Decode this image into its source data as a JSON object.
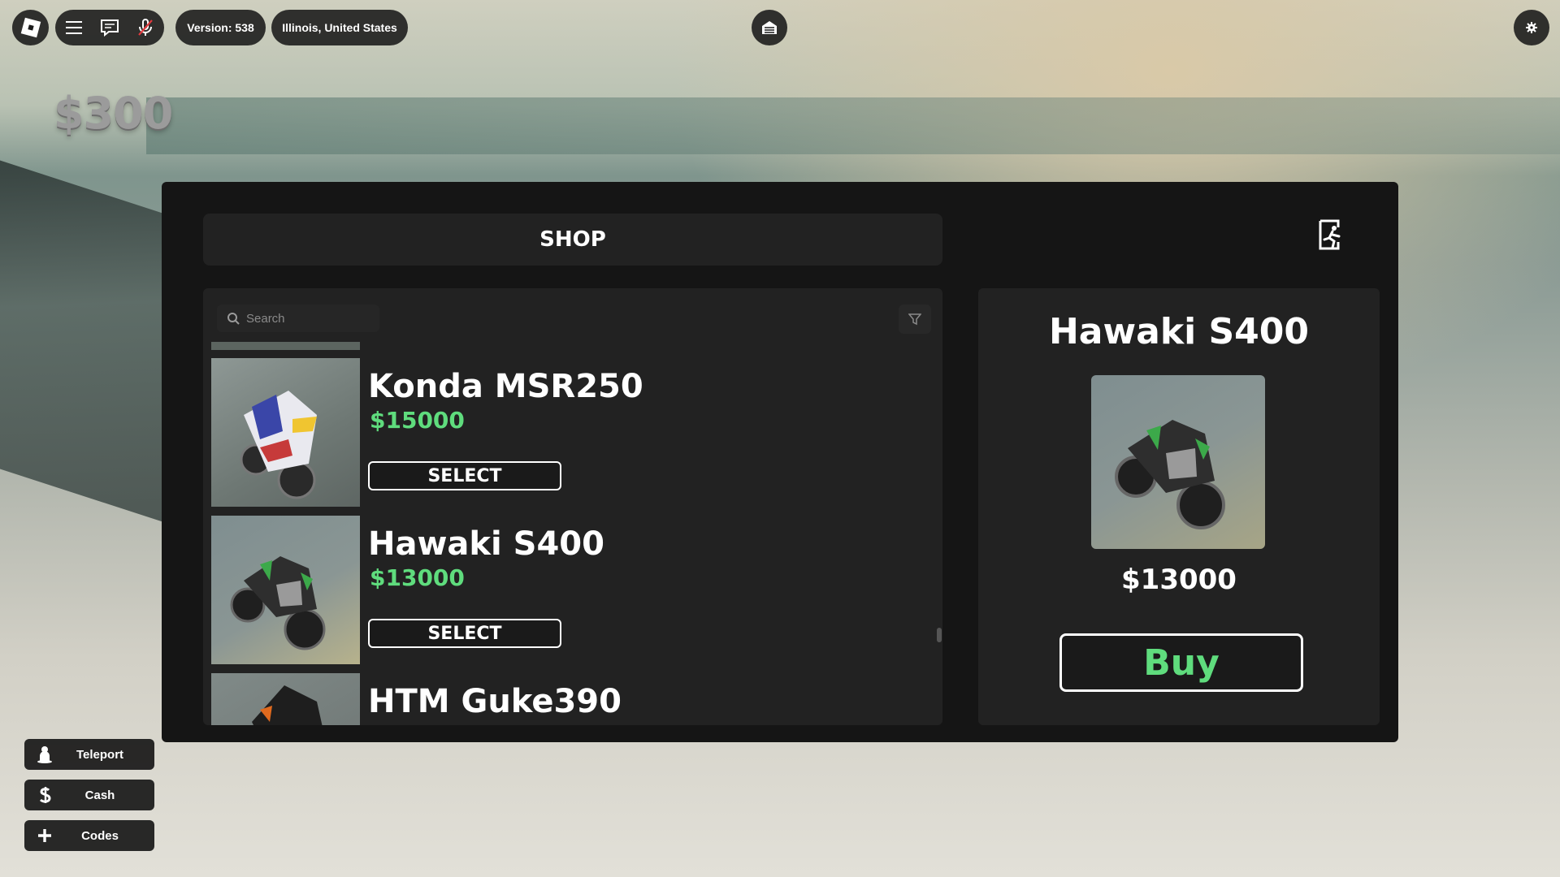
{
  "topbar": {
    "version_label": "Version: 538",
    "region_label": "Illinois, United States"
  },
  "hud": {
    "cash": "$300"
  },
  "shop": {
    "title": "SHOP",
    "search": {
      "placeholder": "Search",
      "value": ""
    },
    "items": [
      {
        "name": "Konda MSR250",
        "price": "$15000",
        "select_label": "SELECT"
      },
      {
        "name": "Hawaki S400",
        "price": "$13000",
        "select_label": "SELECT"
      },
      {
        "name": "HTM Guke390"
      }
    ],
    "detail": {
      "name": "Hawaki S400",
      "price": "$13000",
      "buy_label": "Buy"
    }
  },
  "side_menu": [
    {
      "label": "Teleport",
      "icon": "teleport-icon"
    },
    {
      "label": "Cash",
      "icon": "cash-icon"
    },
    {
      "label": "Codes",
      "icon": "plus-icon"
    }
  ],
  "colors": {
    "price_green": "#5fdc7d",
    "panel_bg": "#151515",
    "card_bg": "#222222"
  }
}
